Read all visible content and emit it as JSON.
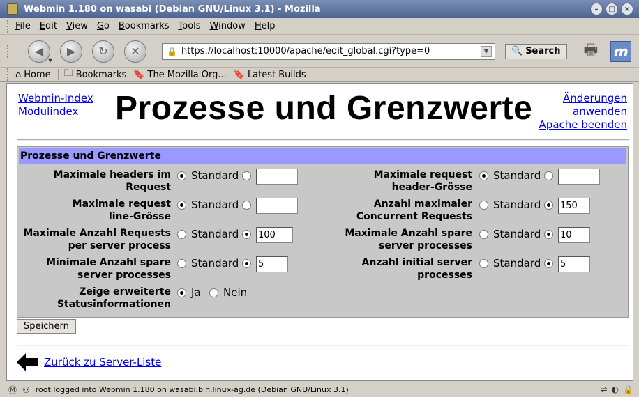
{
  "window": {
    "title": "Webmin 1.180 on wasabi (Debian GNU/Linux 3.1) - Mozilla"
  },
  "menu": [
    {
      "label": "File",
      "u": "F",
      "rest": "ile"
    },
    {
      "label": "Edit",
      "u": "E",
      "rest": "dit"
    },
    {
      "label": "View",
      "u": "V",
      "rest": "iew"
    },
    {
      "label": "Go",
      "u": "G",
      "rest": "o"
    },
    {
      "label": "Bookmarks",
      "u": "B",
      "rest": "ookmarks"
    },
    {
      "label": "Tools",
      "u": "T",
      "rest": "ools"
    },
    {
      "label": "Window",
      "u": "W",
      "rest": "indow"
    },
    {
      "label": "Help",
      "u": "H",
      "rest": "elp"
    }
  ],
  "toolbar": {
    "url": "https://localhost:10000/apache/edit_global.cgi?type=0",
    "search_label": "Search"
  },
  "bookmarks": {
    "home": "Home",
    "bookmarks": "Bookmarks",
    "mozilla_org": "The Mozilla Org...",
    "latest_builds": "Latest Builds"
  },
  "page": {
    "webmin_index": "Webmin-Index",
    "module_index": "Modulindex",
    "title": "Prozesse und Grenzwerte",
    "apply_line1": "Änderungen",
    "apply_line2": "anwenden",
    "stop_apache": "Apache beenden",
    "panel_title": "Prozesse und Grenzwerte",
    "standard": "Standard",
    "yes": "Ja",
    "no": "Nein",
    "save": "Speichern",
    "back": "Zurück zu Server-Liste"
  },
  "fields": {
    "max_headers": {
      "l1": "Maximale headers im",
      "l2": "Request",
      "value": ""
    },
    "max_header_size": {
      "l1": "Maximale request",
      "l2": "header-Grösse",
      "value": ""
    },
    "max_line_size": {
      "l1": "Maximale request",
      "l2": "line-Grösse",
      "value": ""
    },
    "max_concurrent": {
      "l1": "Anzahl maximaler",
      "l2": "Concurrent Requests",
      "value": "150"
    },
    "max_requests": {
      "l1": "Maximale Anzahl Requests",
      "l2": "per server process",
      "value": "100"
    },
    "max_spare": {
      "l1": "Maximale Anzahl spare",
      "l2": "server processes",
      "value": "10"
    },
    "min_spare": {
      "l1": "Minimale Anzahl spare",
      "l2": "server processes",
      "value": "5"
    },
    "initial_servers": {
      "l1": "Anzahl initial server",
      "l2": "processes",
      "value": "5"
    },
    "ext_status": {
      "l1": "Zeige erweiterte",
      "l2": "Statusinformationen"
    }
  },
  "status": {
    "text": "root logged into Webmin 1.180 on wasabi.bln.linux-ag.de (Debian GNU/Linux 3.1)"
  }
}
